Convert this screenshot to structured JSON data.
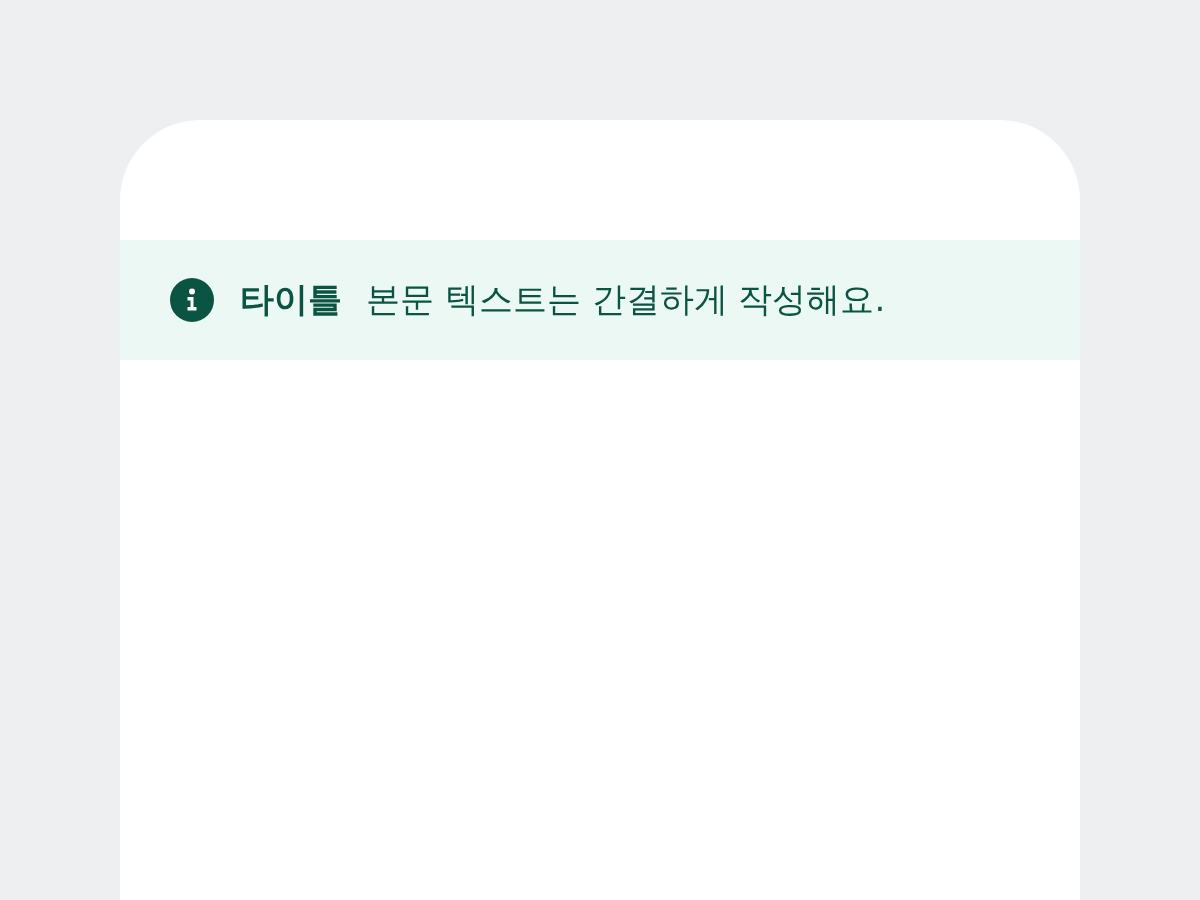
{
  "banner": {
    "title": "타이틀",
    "body": "본문 텍스트는 간결하게 작성해요."
  }
}
